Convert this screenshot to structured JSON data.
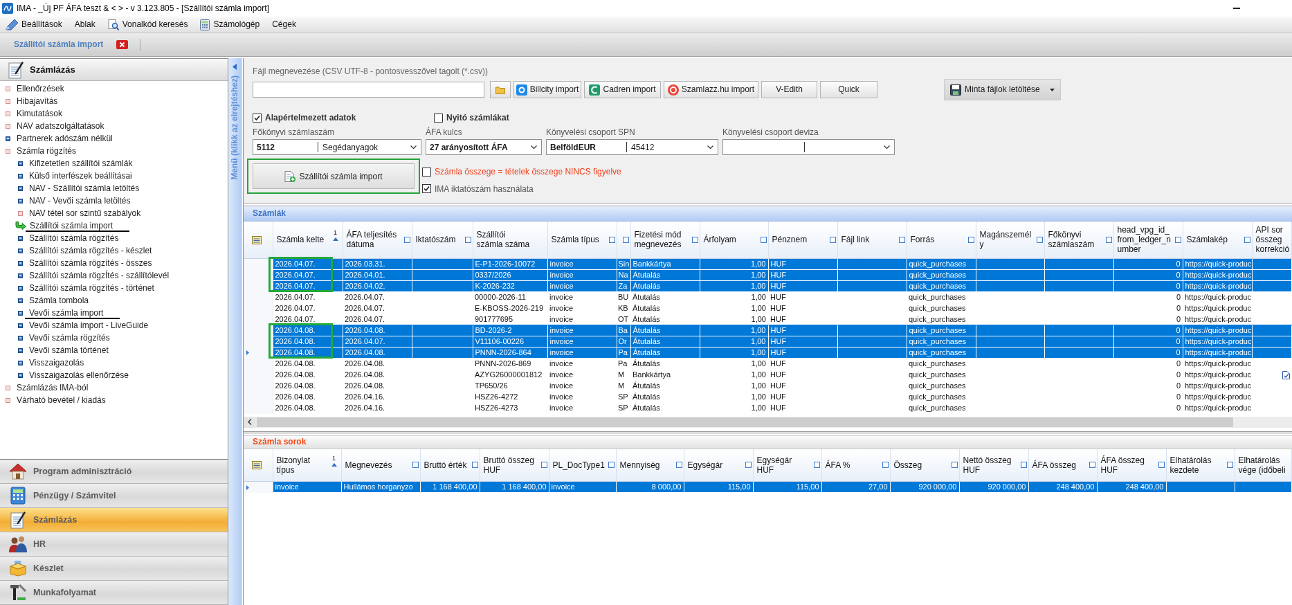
{
  "window": {
    "title": "IMA - _Új PF ÁFA teszt & < > - v 3.123.805 - [Szállítói számla import]"
  },
  "menu": [
    {
      "label": "Beállítások"
    },
    {
      "label": "Ablak"
    },
    {
      "label": "Vonalkód keresés"
    },
    {
      "label": "Számológép"
    },
    {
      "label": "Cégek"
    }
  ],
  "tabs": [
    {
      "label": "Szállítói számla import",
      "selected": true
    }
  ],
  "sidebar": {
    "title": "Számlázás",
    "collapse_label": "Menü (klikk az elrejtéshez)",
    "items": [
      {
        "label": "Ellenőrzések",
        "kind": "folder",
        "selected": false,
        "underlined": false
      },
      {
        "label": "Hibajavítás",
        "kind": "folder",
        "selected": false,
        "underlined": false
      },
      {
        "label": "Kimutatások",
        "kind": "folder",
        "selected": false,
        "underlined": false
      },
      {
        "label": "NAV adatszolgáltatások",
        "kind": "folder",
        "selected": false,
        "underlined": false
      },
      {
        "label": "Partnerek adószám nélkül",
        "kind": "page",
        "selected": false,
        "underlined": false
      },
      {
        "label": "Számla rögzítés",
        "kind": "folder",
        "selected": false,
        "underlined": false,
        "children": [
          {
            "label": "Kifizetetlen szállítói számlák",
            "kind": "page",
            "selected": false,
            "underlined": false
          },
          {
            "label": "Külső interfészek beállításai",
            "kind": "page",
            "selected": false,
            "underlined": false
          },
          {
            "label": "NAV - Szállítói számla letöltés",
            "kind": "page",
            "selected": false,
            "underlined": false
          },
          {
            "label": "NAV - Vevői számla letöltés",
            "kind": "page",
            "selected": false,
            "underlined": false
          },
          {
            "label": "NAV tétel sor szintű szabályok",
            "kind": "folder",
            "selected": false,
            "underlined": false
          },
          {
            "label": "Szállítói számla import",
            "selected": true,
            "underlined": true
          },
          {
            "label": "Szállítói számla rögzítés",
            "kind": "page",
            "selected": false,
            "underlined": false
          },
          {
            "label": "Szállítói számla rögzítés - készlet",
            "kind": "page",
            "selected": false,
            "underlined": false
          },
          {
            "label": "Szállítói számla rögzítés - összes",
            "kind": "page",
            "selected": false,
            "underlined": false
          },
          {
            "label": "Szállítói számla rögzÍtés - szállítólevél",
            "kind": "page",
            "selected": false,
            "underlined": false
          },
          {
            "label": "Szállítói számla rögzítés - történet",
            "kind": "page",
            "selected": false,
            "underlined": false
          },
          {
            "label": "Számla tombola",
            "kind": "page",
            "selected": false,
            "underlined": false
          },
          {
            "label": "Vevői számla import",
            "kind": "page",
            "selected": false,
            "underlined": true
          },
          {
            "label": "Vevői számla import - LiveGuide",
            "kind": "page",
            "selected": false,
            "underlined": false
          },
          {
            "label": "Vevői számla rögzítés",
            "kind": "page",
            "selected": false,
            "underlined": false
          },
          {
            "label": "Vevői számla történet",
            "kind": "page",
            "selected": false,
            "underlined": false
          },
          {
            "label": "Visszaigazolás",
            "kind": "page",
            "selected": false,
            "underlined": false
          },
          {
            "label": "Visszaigazolás ellenőrzése",
            "kind": "page",
            "selected": false,
            "underlined": false
          }
        ]
      },
      {
        "label": "Számlázás IMA-ból",
        "kind": "folder",
        "selected": false,
        "underlined": false
      },
      {
        "label": "Várható bevétel / kiadás",
        "kind": "folder",
        "selected": false,
        "underlined": false
      }
    ]
  },
  "nav": [
    {
      "label": "Program adminisztráció",
      "selected": false
    },
    {
      "label": "Pénzügy / Számvitel",
      "selected": false
    },
    {
      "label": "Számlázás",
      "selected": true
    },
    {
      "label": "HR",
      "selected": false
    },
    {
      "label": "Készlet",
      "selected": false
    },
    {
      "label": "Munkafolyamat",
      "selected": false
    }
  ],
  "import_panel": {
    "file_label": "Fájl megnevezése (CSV UTF-8 - pontosvesszővel tagolt (*.csv))",
    "buttons": [
      {
        "label": "Billcity import"
      },
      {
        "label": "Cadren import"
      },
      {
        "label": "Szamlazz.hu import"
      },
      {
        "label": "V-Edith"
      },
      {
        "label": "Quick"
      }
    ],
    "download_button": {
      "label": "Minta fájlok letöltése"
    },
    "checkboxes": [
      {
        "label": "Alapértelmezett adatok",
        "checked": true
      },
      {
        "label": "Nyitó számlákat",
        "checked": false
      }
    ],
    "fields": [
      {
        "label": "Főkönyvi számlaszám",
        "kind": "split",
        "code": "5112",
        "name": "Segédanyagok"
      },
      {
        "label": "ÁFA kulcs",
        "kind": "single",
        "value": "27 arányosított ÁFA"
      },
      {
        "label": "Könyvelési csoport SPN",
        "kind": "split",
        "code": "BelföldEUR",
        "name": "45412"
      },
      {
        "label": "Könyvelési csoport deviza",
        "kind": "split"
      }
    ],
    "import_button": {
      "label": "Szállítói számla import",
      "circled": true
    },
    "options": [
      {
        "label": "Számla összege = tételek összege NINCS figyelve",
        "kind": "warning",
        "checked": false
      },
      {
        "label": "IMA iktatószám használata",
        "kind": "normal",
        "checked": true
      }
    ]
  },
  "invoices": {
    "title": "Számlák",
    "columns": [
      {
        "label": "Számla kelte",
        "kind": "text",
        "sorted": true,
        "sort_rank": "1",
        "filter": false
      },
      {
        "label": "ÁFA teljesítés dátuma",
        "kind": "text",
        "sorted": false,
        "filter": true
      },
      {
        "label": "Iktatószám",
        "kind": "text",
        "sorted": false,
        "filter": true
      },
      {
        "label": "Szállítói számla száma",
        "kind": "text",
        "sorted": false,
        "filter": false
      },
      {
        "label": "Számla típus",
        "kind": "text",
        "sorted": false,
        "filter": true
      },
      {
        "kind": "text",
        "sorted": false,
        "filter": true
      },
      {
        "label": "Fizetési mód megnevezés",
        "kind": "text",
        "sorted": false,
        "filter": true
      },
      {
        "label": "Árfolyam",
        "kind": "number",
        "sorted": false,
        "filter": true
      },
      {
        "label": "Pénznem",
        "kind": "text",
        "sorted": false,
        "filter": true
      },
      {
        "label": "Fájl link",
        "kind": "text",
        "sorted": false,
        "filter": true
      },
      {
        "label": "Forrás",
        "kind": "text",
        "sorted": false,
        "filter": true
      },
      {
        "label": "Magánszemély",
        "kind": "text",
        "sorted": false,
        "filter": true
      },
      {
        "label": "Főkönyvi számlaszám",
        "kind": "text",
        "sorted": false,
        "filter": true
      },
      {
        "label": "head_vpg_id_from_ledger_number",
        "kind": "number",
        "sorted": false,
        "filter": true
      },
      {
        "label": "Számlakép",
        "kind": "text",
        "sorted": false,
        "filter": true
      },
      {
        "label": "API sor összeg korrekció",
        "kind": "text",
        "sorted": false,
        "filter": false
      }
    ],
    "rows": [
      {
        "cells": [
          "2026.04.07.",
          "2026.03.31.",
          null,
          "E-P1-2026-10072",
          "invoice",
          "Sin",
          "Bankkártya",
          "1,00",
          "HUF",
          null,
          "quick_purchases",
          null,
          null,
          "0",
          "https://quick-produc",
          null
        ],
        "selected": true,
        "current": false,
        "circled": true,
        "api_icon": false
      },
      {
        "cells": [
          "2026.04.07.",
          "2026.04.01.",
          null,
          "0337/2026",
          "invoice",
          "Na",
          "Átutalás",
          "1,00",
          "HUF",
          null,
          "quick_purchases",
          null,
          null,
          "0",
          "https://quick-produc",
          null
        ],
        "selected": true,
        "current": false,
        "circled": true,
        "api_icon": false
      },
      {
        "cells": [
          "2026.04.07.",
          "2026.04.02.",
          null,
          "K-2026-232",
          "invoice",
          "Za",
          "Átutalás",
          "1,00",
          "HUF",
          null,
          "quick_purchases",
          null,
          null,
          "0",
          "https://quick-produc",
          null
        ],
        "selected": true,
        "current": false,
        "circled": true,
        "api_icon": false
      },
      {
        "cells": [
          "2026.04.07.",
          "2026.04.07.",
          null,
          "00000-2026-11",
          "invoice",
          "BU",
          "Átutalás",
          "1,00",
          "HUF",
          null,
          "quick_purchases",
          null,
          null,
          "0",
          "https://quick-produc",
          null
        ],
        "selected": false,
        "current": false,
        "circled": false,
        "api_icon": false
      },
      {
        "cells": [
          "2026.04.07.",
          "2026.04.07.",
          null,
          "E-KBOSS-2026-219",
          "invoice",
          "KB",
          "Átutalás",
          "1,00",
          "HUF",
          null,
          "quick_purchases",
          null,
          null,
          "0",
          "https://quick-produc",
          null
        ],
        "selected": false,
        "current": false,
        "circled": false,
        "api_icon": false
      },
      {
        "cells": [
          "2026.04.07.",
          "2026.04.07.",
          null,
          "901777695",
          "invoice",
          "OT",
          "Átutalás",
          "1,00",
          "HUF",
          null,
          "quick_purchases",
          null,
          null,
          "0",
          "https://quick-produc",
          null
        ],
        "selected": false,
        "current": false,
        "circled": false,
        "api_icon": false
      },
      {
        "cells": [
          "2026.04.08.",
          "2026.04.08.",
          null,
          "BD-2026-2",
          "invoice",
          "Ba",
          "Átutalás",
          "1,00",
          "HUF",
          null,
          "quick_purchases",
          null,
          null,
          "0",
          "https://quick-produc",
          null
        ],
        "selected": true,
        "current": false,
        "circled": true,
        "api_icon": false
      },
      {
        "cells": [
          "2026.04.08.",
          "2026.04.07.",
          null,
          "V11106-00226",
          "invoice",
          "Or",
          "Átutalás",
          "1,00",
          "HUF",
          null,
          "quick_purchases",
          null,
          null,
          "0",
          "https://quick-produc",
          null
        ],
        "selected": true,
        "current": false,
        "circled": true,
        "api_icon": false
      },
      {
        "cells": [
          "2026.04.08.",
          "2026.04.08.",
          null,
          "PNNN-2026-864",
          "invoice",
          "Pa",
          "Átutalás",
          "1,00",
          "HUF",
          null,
          "quick_purchases",
          null,
          null,
          "0",
          "https://quick-produc",
          null
        ],
        "selected": true,
        "current": true,
        "circled": true,
        "api_icon": false
      },
      {
        "cells": [
          "2026.04.08.",
          "2026.04.08.",
          null,
          "PNNN-2026-869",
          "invoice",
          "Pa",
          "Átutalás",
          "1,00",
          "HUF",
          null,
          "quick_purchases",
          null,
          null,
          "0",
          "https://quick-produc",
          null
        ],
        "selected": false,
        "current": false,
        "circled": false,
        "api_icon": false
      },
      {
        "cells": [
          "2026.04.08.",
          "2026.04.08.",
          null,
          "AZYG26000001812",
          "invoice",
          "M",
          "Bankkártya",
          "1,00",
          "HUF",
          null,
          "quick_purchases",
          null,
          null,
          "0",
          "https://quick-produc",
          null
        ],
        "selected": false,
        "current": false,
        "circled": false,
        "api_icon": true
      },
      {
        "cells": [
          "2026.04.08.",
          "2026.04.08.",
          null,
          "TP650/26",
          "invoice",
          "M",
          "Átutalás",
          "1,00",
          "HUF",
          null,
          "quick_purchases",
          null,
          null,
          "0",
          "https://quick-produc",
          null
        ],
        "selected": false,
        "current": false,
        "circled": false,
        "api_icon": false
      },
      {
        "cells": [
          "2026.04.08.",
          "2026.04.16.",
          null,
          "HSZ26-4272",
          "invoice",
          "SP",
          "Átutalás",
          "1,00",
          "HUF",
          null,
          "quick_purchases",
          null,
          null,
          "0",
          "https://quick-produc",
          null
        ],
        "selected": false,
        "current": false,
        "circled": false,
        "api_icon": false
      },
      {
        "cells": [
          "2026.04.08.",
          "2026.04.16.",
          null,
          "HSZ26-4273",
          "invoice",
          "SP",
          "Átutalás",
          "1,00",
          "HUF",
          null,
          "quick_purchases",
          null,
          null,
          "0",
          "https://quick-produc",
          null
        ],
        "selected": false,
        "current": false,
        "circled": false,
        "api_icon": false
      }
    ]
  },
  "invoice_lines": {
    "title": "Számla sorok",
    "columns": [
      {
        "label": "Bizonylat típus",
        "kind": "text",
        "sorted": true,
        "sort_rank": "1",
        "filter": false
      },
      {
        "label": "Megnevezés",
        "kind": "text",
        "sorted": false,
        "filter": true
      },
      {
        "label": "Bruttó érték",
        "kind": "number",
        "sorted": false,
        "filter": true
      },
      {
        "label": "Bruttó összeg HUF",
        "kind": "number",
        "sorted": false,
        "filter": true
      },
      {
        "label": "PL_DocType1",
        "kind": "text",
        "sorted": false,
        "filter": true
      },
      {
        "label": "Mennyiség",
        "kind": "number",
        "sorted": false,
        "filter": true
      },
      {
        "label": "Egységár",
        "kind": "number",
        "sorted": false,
        "filter": true
      },
      {
        "label": "Egységár HUF",
        "kind": "number",
        "sorted": false,
        "filter": true
      },
      {
        "label": "ÁFA %",
        "kind": "number",
        "sorted": false,
        "filter": true
      },
      {
        "label": "Összeg",
        "kind": "number",
        "sorted": false,
        "filter": true
      },
      {
        "label": "Nettó összeg HUF",
        "kind": "number",
        "sorted": false,
        "filter": true
      },
      {
        "label": "ÁFA összeg",
        "kind": "number",
        "sorted": false,
        "filter": true
      },
      {
        "label": "ÁFA összeg HUF",
        "kind": "number",
        "sorted": false,
        "filter": true
      },
      {
        "label": "Elhatárolás kezdete",
        "kind": "text",
        "sorted": false,
        "filter": true
      },
      {
        "label": "Elhatárolás vége (időbeli",
        "kind": "text",
        "sorted": false,
        "filter": false
      }
    ],
    "rows": [
      {
        "cells": [
          "invoice",
          "Hullámos horganyzo",
          "1 168 400,00",
          "1 168 400,00",
          "invoice",
          "8 000,00",
          "115,00",
          "115,00",
          "27,00",
          "920 000,00",
          "920 000,00",
          "248 400,00",
          "248 400,00",
          null,
          null
        ],
        "selected": true,
        "current": true,
        "circled": false,
        "api_icon": false
      }
    ]
  }
}
